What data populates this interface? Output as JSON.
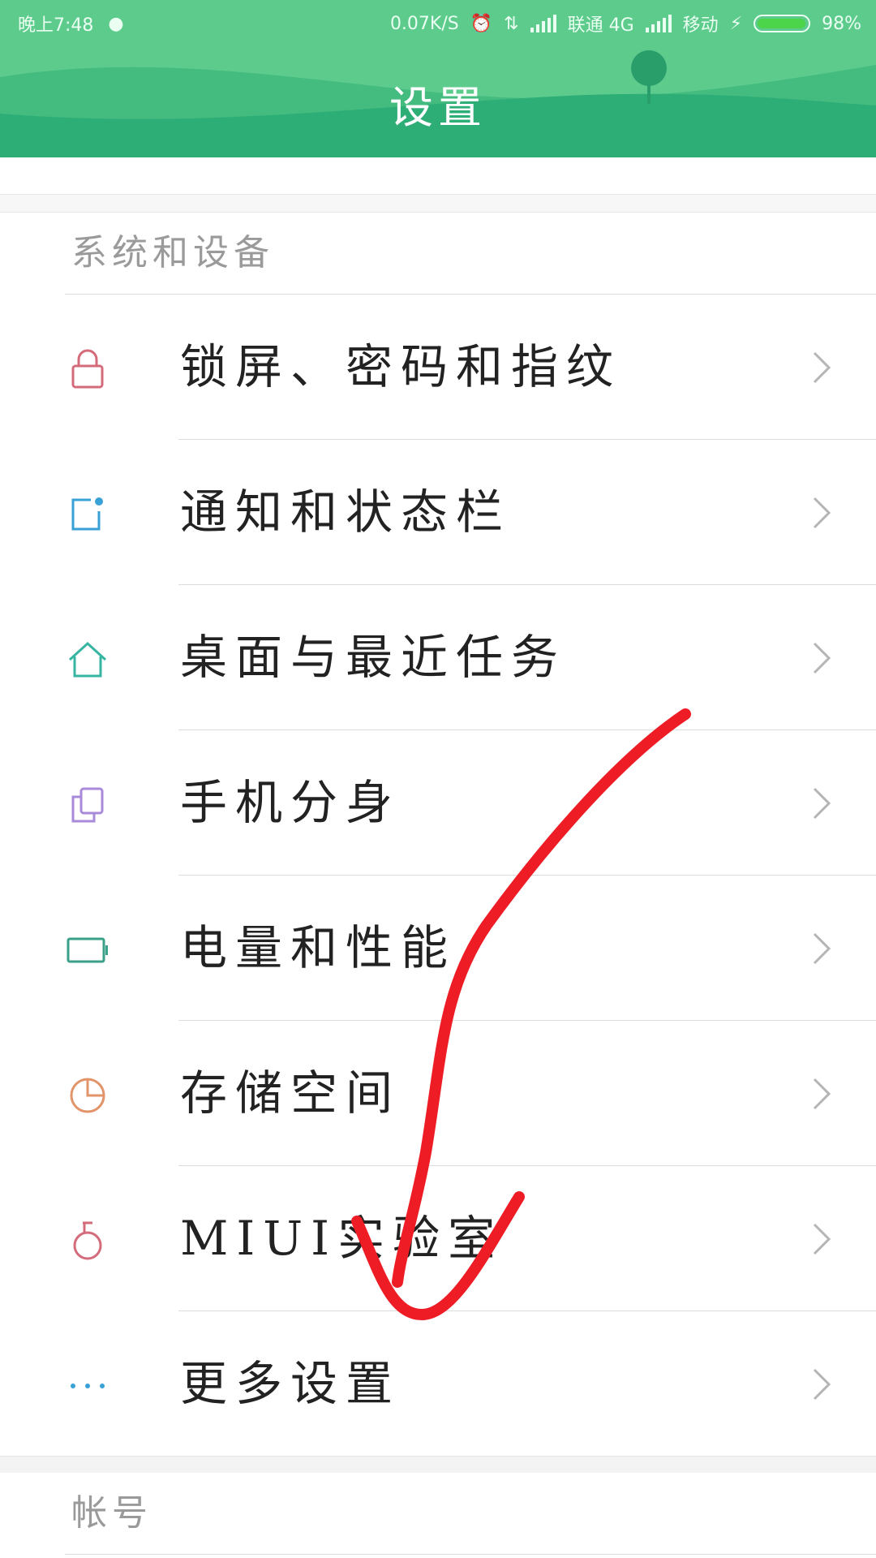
{
  "status_bar": {
    "time": "晚上7:48",
    "net_speed": "0.07K/S",
    "carrier1": "联通 4G",
    "carrier2": "移动",
    "battery": "98%",
    "battery_level": 0.98
  },
  "header": {
    "title": "设置"
  },
  "sections": [
    {
      "title": "系统和设备",
      "items": [
        {
          "label": "锁屏、密码和指纹",
          "icon": "lock-icon",
          "color": "#d46b7a"
        },
        {
          "label": "通知和状态栏",
          "icon": "notification-icon",
          "color": "#3aa1d6"
        },
        {
          "label": "桌面与最近任务",
          "icon": "home-icon",
          "color": "#37b5a3"
        },
        {
          "label": "手机分身",
          "icon": "clone-icon",
          "color": "#a88ad8"
        },
        {
          "label": "电量和性能",
          "icon": "battery-icon",
          "color": "#3aa08a"
        },
        {
          "label": "存储空间",
          "icon": "pie-chart-icon",
          "color": "#e2946a"
        },
        {
          "label": "MIUI实验室",
          "icon": "flask-icon",
          "color": "#d46b7a"
        },
        {
          "label": "更多设置",
          "icon": "more-icon",
          "color": "#3aa1d6"
        }
      ]
    },
    {
      "title": "帐号"
    }
  ],
  "colors": {
    "header_green": "#5ccb8c",
    "annotation_red": "#ee1c24"
  }
}
